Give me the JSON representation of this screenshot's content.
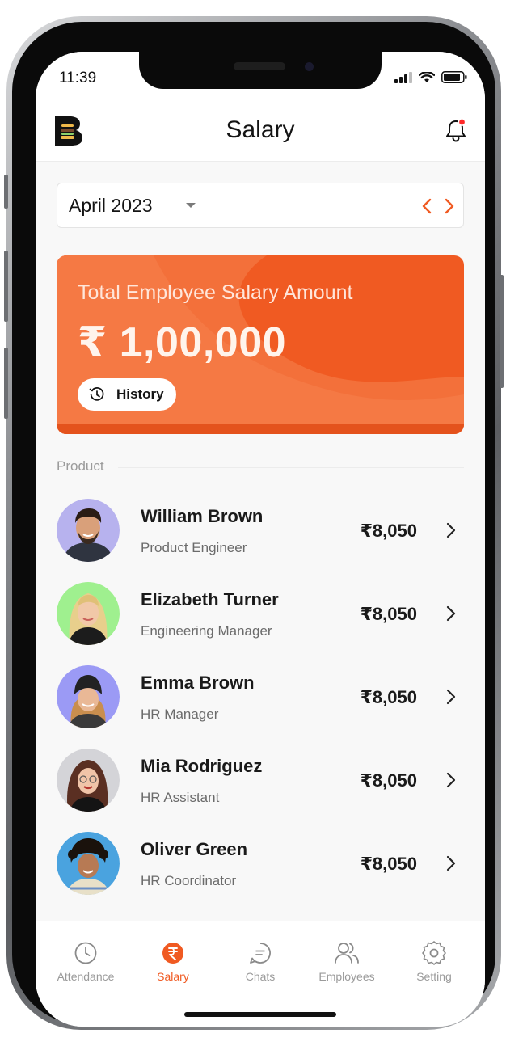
{
  "status_bar": {
    "time": "11:39"
  },
  "header": {
    "title": "Salary",
    "logo_icon": "brand-logo-icon",
    "notification_icon": "bell-icon"
  },
  "month_picker": {
    "value": "April 2023"
  },
  "summary_card": {
    "label": "Total Employee Salary Amount",
    "amount": "₹ 1,00,000",
    "history_label": "History"
  },
  "section": {
    "label": "Product"
  },
  "employees": [
    {
      "name": "William Brown",
      "role": "Product Engineer",
      "amount": "₹8,050",
      "avatar_bg": "#b7b2ee"
    },
    {
      "name": "Elizabeth Turner",
      "role": "Engineering Manager",
      "amount": "₹8,050",
      "avatar_bg": "#9ff08f"
    },
    {
      "name": "Emma Brown",
      "role": "HR Manager",
      "amount": "₹8,050",
      "avatar_bg": "#9b9af5"
    },
    {
      "name": "Mia Rodriguez",
      "role": "HR Assistant",
      "amount": "₹8,050",
      "avatar_bg": "#d4d4d8"
    },
    {
      "name": "Oliver Green",
      "role": "HR Coordinator",
      "amount": "₹8,050",
      "avatar_bg": "#4aa3df"
    }
  ],
  "tabs": [
    {
      "label": "Attendance",
      "icon": "clock-icon"
    },
    {
      "label": "Salary",
      "icon": "rupee-icon",
      "active": true
    },
    {
      "label": "Chats",
      "icon": "chat-icon"
    },
    {
      "label": "Employees",
      "icon": "users-icon"
    },
    {
      "label": "Setting",
      "icon": "gear-icon"
    }
  ],
  "colors": {
    "accent": "#f05a22",
    "text": "#1a1a1a",
    "muted": "#9b9b9b"
  }
}
